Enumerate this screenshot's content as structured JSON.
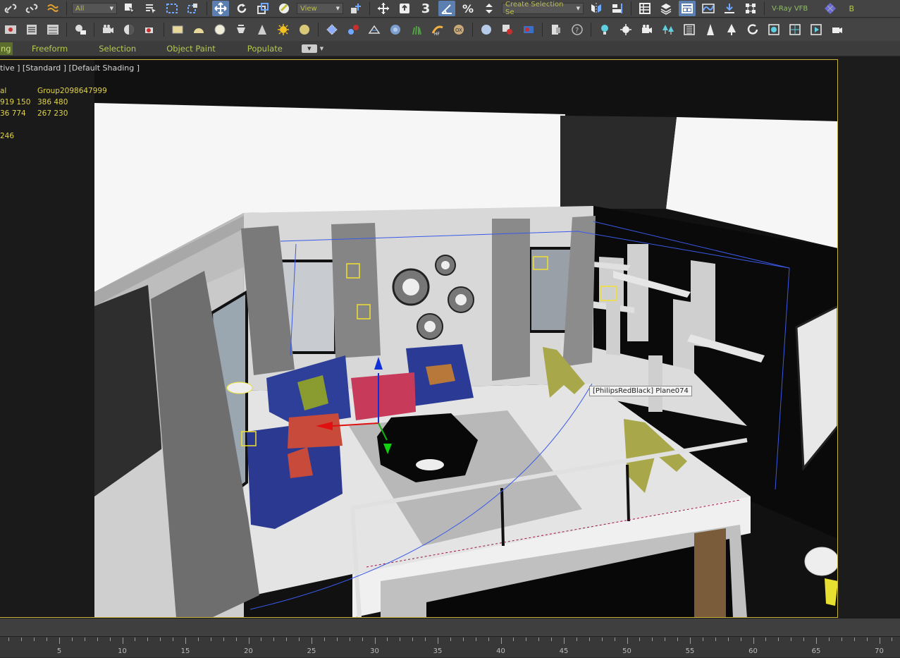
{
  "toolbar_top": {
    "filter_dropdown": "All",
    "view_dropdown": "View",
    "angle_snap_label": "3",
    "selection_set_dropdown": "Create Selection Se",
    "vray_vfb_label": "V-Ray VFB"
  },
  "ribbon": {
    "tabs": [
      {
        "label": "ng"
      },
      {
        "label": "Freeform"
      },
      {
        "label": "Selection"
      },
      {
        "label": "Object Paint"
      },
      {
        "label": "Populate"
      }
    ]
  },
  "viewport": {
    "label": "tive ] [Standard ] [Default Shading ]",
    "stats": {
      "header": [
        "al",
        "Group2098647999"
      ],
      "row1": [
        "919 150",
        "386 480"
      ],
      "row2": [
        "36 774",
        "267 230"
      ],
      "row3": [
        "246",
        ""
      ]
    },
    "tooltip": "[PhilipsRedBlack] Plane074"
  },
  "timeline": {
    "ticks": [
      "5",
      "10",
      "15",
      "20",
      "25",
      "30",
      "35",
      "40",
      "45",
      "50",
      "55",
      "60",
      "65",
      "70"
    ]
  },
  "colors": {
    "accent_yellow": "#c8b43a",
    "ribbon_text": "#b5c952",
    "stats_text": "#e1d24a",
    "active_button": "#5a7fb0"
  }
}
